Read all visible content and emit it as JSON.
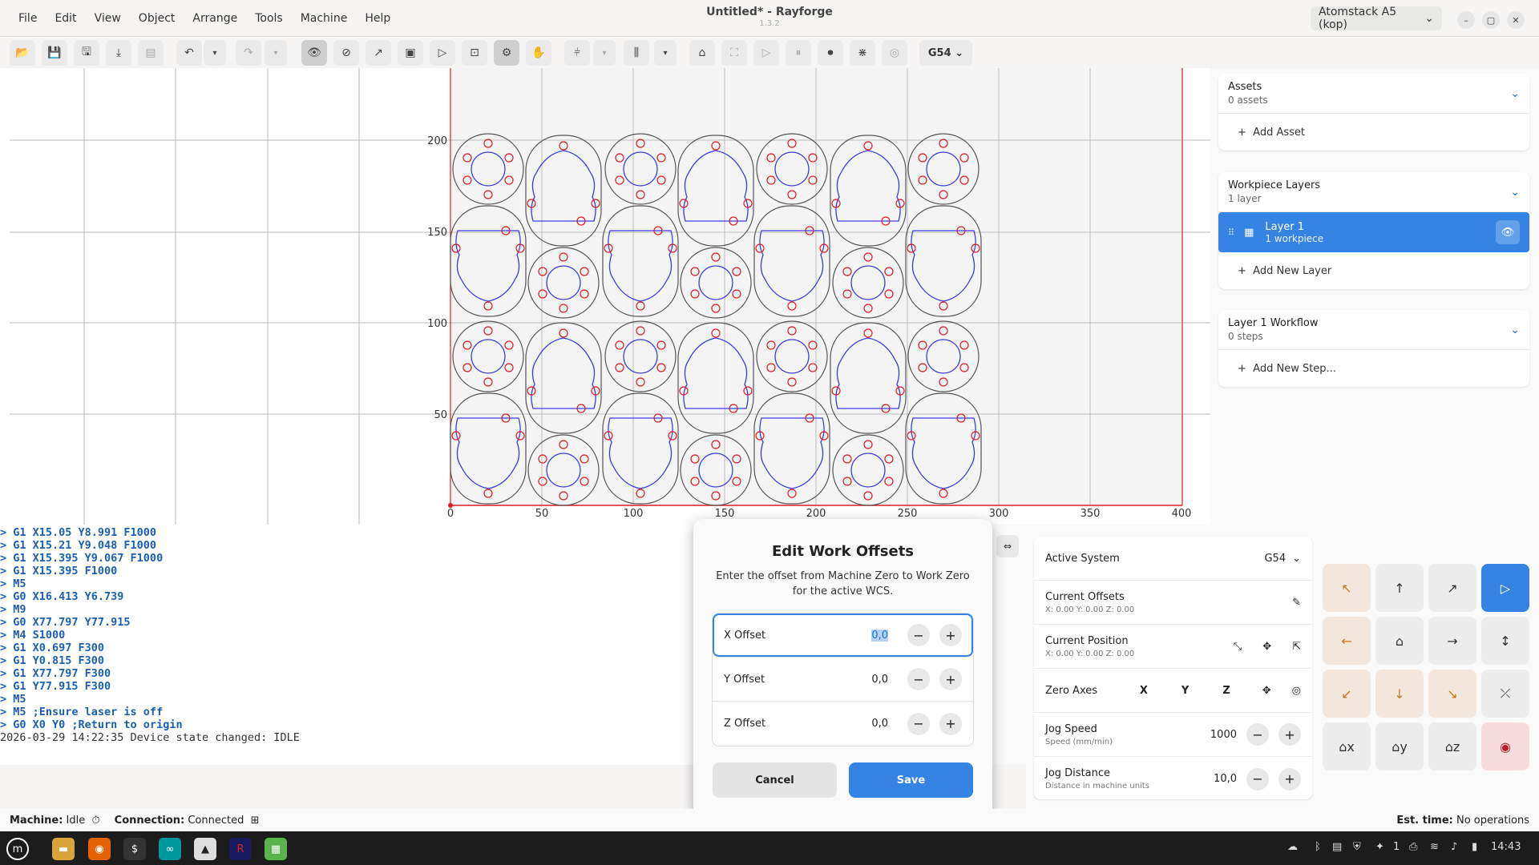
{
  "window": {
    "title": "Untitled* - Rayforge",
    "version": "1.3.2",
    "machine": "Atomstack A5 (kop)"
  },
  "menu": [
    "File",
    "Edit",
    "View",
    "Object",
    "Arrange",
    "Tools",
    "Machine",
    "Help"
  ],
  "toolbar": {
    "wcs": "G54"
  },
  "canvas": {
    "x_ticks": [
      "0",
      "50",
      "100",
      "150",
      "200",
      "250",
      "300",
      "350",
      "400"
    ],
    "y_ticks": [
      "50",
      "100",
      "150",
      "200"
    ]
  },
  "sidebar": {
    "assets": {
      "title": "Assets",
      "subtitle": "0 assets",
      "add": "Add Asset"
    },
    "layers": {
      "title": "Workpiece Layers",
      "subtitle": "1 layer",
      "layer_name": "Layer 1",
      "layer_sub": "1 workpiece",
      "add": "Add New Layer"
    },
    "workflow": {
      "title": "Layer 1 Workflow",
      "subtitle": "0 steps",
      "add": "Add New Step..."
    }
  },
  "console": [
    "> G1 X15.05 Y8.991 F1000",
    "> G1 X15.21 Y9.048 F1000",
    "> G1 X15.395 Y9.067 F1000",
    "> G1 X15.395 F1000",
    "> M5",
    "> G0 X16.413 Y6.739",
    "> M9",
    "> G0 X77.797 Y77.915",
    "> M4 S1000",
    "> G1 X0.697 F300",
    "> G1 Y0.815 F300",
    "> G1 X77.797 F300",
    "> G1 Y77.915 F300",
    "> M5",
    "> M5 ;Ensure laser is off",
    "> G0 X0 Y0 ;Return to origin"
  ],
  "console_last": "2026-03-29 14:22:35 Device state changed: IDLE",
  "dialog": {
    "title": "Edit Work Offsets",
    "desc": "Enter the offset from Machine Zero to Work Zero for the active WCS.",
    "x_label": "X Offset",
    "x_val": "0,0",
    "y_label": "Y Offset",
    "y_val": "0,0",
    "z_label": "Z Offset",
    "z_val": "0,0",
    "cancel": "Cancel",
    "save": "Save"
  },
  "control": {
    "active_label": "Active System",
    "active_val": "G54",
    "offsets_label": "Current Offsets",
    "offsets_val": "X: 0.00   Y: 0.00   Z: 0.00",
    "pos_label": "Current Position",
    "pos_val": "X: 0.00   Y: 0.00   Z: 0.00",
    "zero_label": "Zero Axes",
    "ax": "X",
    "ay": "Y",
    "az": "Z",
    "speed_label": "Jog Speed",
    "speed_sub": "Speed (mm/min)",
    "speed_val": "1000",
    "dist_label": "Jog Distance",
    "dist_sub": "Distance in machine units",
    "dist_val": "10,0"
  },
  "status": {
    "machine_label": "Machine:",
    "machine_val": "Idle",
    "conn_label": "Connection:",
    "conn_val": "Connected",
    "est_label": "Est. time:",
    "est_val": "No operations"
  },
  "taskbar": {
    "badge": "1",
    "clock": "14:43"
  },
  "colors": {
    "accent": "#3584e4",
    "axis": "#e01b24",
    "path_outer": "#555555",
    "path_red": "#e01b24",
    "path_blue": "#3c3ce0"
  }
}
